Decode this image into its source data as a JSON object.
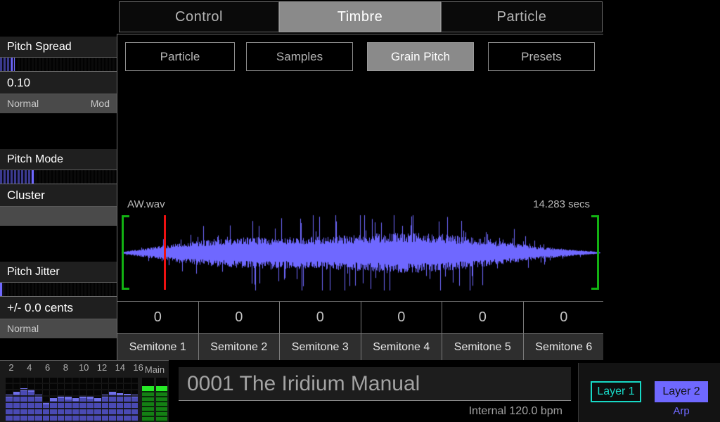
{
  "tabs": [
    {
      "label": "Control",
      "active": false
    },
    {
      "label": "Timbre",
      "active": true
    },
    {
      "label": "Particle",
      "active": false
    }
  ],
  "subtabs": [
    {
      "label": "Particle",
      "active": false
    },
    {
      "label": "Samples",
      "active": false
    },
    {
      "label": "Grain Pitch",
      "active": true
    },
    {
      "label": "Presets",
      "active": false
    }
  ],
  "sidebar": {
    "params": [
      {
        "title": "Pitch Spread",
        "value": "0.10",
        "sub_left": "Normal",
        "sub_right": "Mod",
        "slider_percent": 10
      },
      {
        "title": "Pitch Mode",
        "value": "Cluster",
        "sub_left": "",
        "sub_right": "",
        "slider_percent": 27
      },
      {
        "title": "Pitch Jitter",
        "value": "+/- 0.0 cents",
        "sub_left": "Normal",
        "sub_right": "",
        "slider_percent": 0
      }
    ]
  },
  "waveform": {
    "filename": "AW.wav",
    "duration": "14.283 secs",
    "playhead_percent": 9.5,
    "start_marker_percent": 0.6,
    "end_marker_percent": 99.0,
    "marker_color": "#12b212",
    "playhead_color": "#ee1111",
    "wave_color": "#6f68ff"
  },
  "semitones": [
    {
      "label": "Semitone 1",
      "value": "0"
    },
    {
      "label": "Semitone 2",
      "value": "0"
    },
    {
      "label": "Semitone 3",
      "value": "0"
    },
    {
      "label": "Semitone 4",
      "value": "0"
    },
    {
      "label": "Semitone 5",
      "value": "0"
    },
    {
      "label": "Semitone 6",
      "value": "0"
    }
  ],
  "bottom": {
    "meter": {
      "scale_ticks": [
        "2",
        "4",
        "6",
        "8",
        "10",
        "12",
        "14",
        "16"
      ],
      "main_label": "Main",
      "channel_levels": [
        56,
        63,
        70,
        68,
        56,
        40,
        48,
        54,
        52,
        48,
        55,
        53,
        48,
        56,
        63,
        60,
        58,
        57
      ],
      "main_levels": [
        78,
        78
      ]
    },
    "patch_name": "0001 The Iridium Manual",
    "tempo": "Internal 120.0 bpm",
    "layers": [
      {
        "label": "Layer 1",
        "active": false,
        "color": "#17d9c6"
      },
      {
        "label": "Layer 2",
        "active": true,
        "color": "#6f68ff"
      }
    ],
    "arp_label": "Arp"
  },
  "colors": {
    "accent_blue": "#6f68ff",
    "accent_cyan": "#17d9c6",
    "meter_green": "#27e927",
    "active_tab_bg": "#8a8a8a"
  }
}
